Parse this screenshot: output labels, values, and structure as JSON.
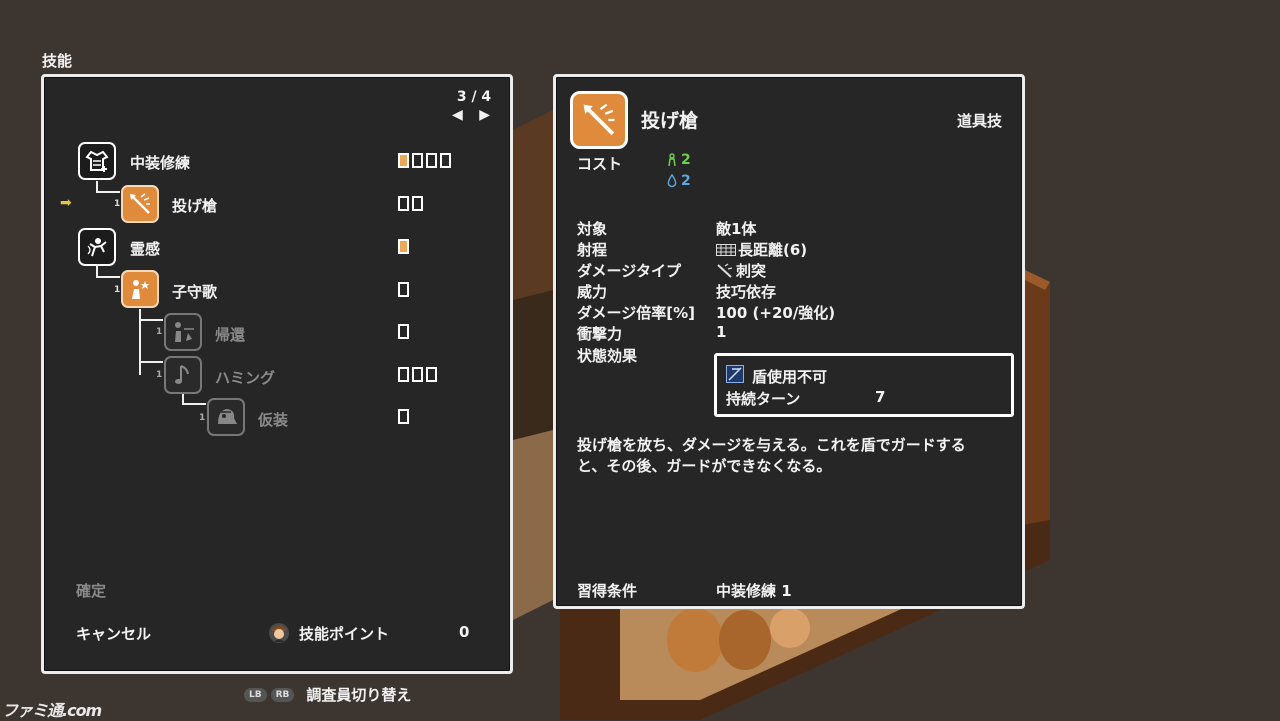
{
  "screen_title": "技能",
  "skill_tree": {
    "page": "3 / 4",
    "page_arrows": "◀ ▶",
    "nodes": [
      {
        "name": "中装修練",
        "level": "",
        "boxes_total": 4,
        "boxes_filled": 1,
        "state": "learned"
      },
      {
        "name": "投げ槍",
        "level": "1",
        "boxes_total": 2,
        "boxes_filled": 0,
        "state": "selected"
      },
      {
        "name": "霊感",
        "level": "",
        "boxes_total": 1,
        "boxes_filled": 1,
        "state": "learned"
      },
      {
        "name": "子守歌",
        "level": "1",
        "boxes_total": 1,
        "boxes_filled": 0,
        "state": "available"
      },
      {
        "name": "帰還",
        "level": "1",
        "boxes_total": 1,
        "boxes_filled": 0,
        "state": "locked"
      },
      {
        "name": "ハミング",
        "level": "1",
        "boxes_total": 3,
        "boxes_filled": 0,
        "state": "locked"
      },
      {
        "name": "仮装",
        "level": "1",
        "boxes_total": 1,
        "boxes_filled": 0,
        "state": "locked"
      }
    ],
    "confirm_label": "確定",
    "cancel_label": "キャンセル",
    "points_label": "技能ポイント",
    "points_value": "0"
  },
  "detail": {
    "name": "投げ槍",
    "category": "道具技",
    "cost_label": "コスト",
    "cost_stamina": "2",
    "cost_mana": "2",
    "stats": [
      {
        "label": "対象",
        "value": "敵1体"
      },
      {
        "label": "射程",
        "value": "長距離(6)"
      },
      {
        "label": "ダメージタイプ",
        "value": "刺突"
      },
      {
        "label": "威力",
        "value": "技巧依存"
      },
      {
        "label": "ダメージ倍率[%]",
        "value": "100 (+20/強化)"
      },
      {
        "label": "衝撃力",
        "value": "1"
      },
      {
        "label": "状態効果",
        "value": ""
      }
    ],
    "effect": {
      "name": "盾使用不可",
      "duration_label": "持続ターン",
      "duration_value": "7"
    },
    "description_line1": "投げ槍を放ち、ダメージを与える。これを盾でガードする",
    "description_line2": "と、その後、ガードができなくなる。",
    "requirement_label": "習得条件",
    "requirement_value": "中装修練 1"
  },
  "bottom_bar": {
    "lb": "LB",
    "rb": "RB",
    "label": "調査員切り替え"
  },
  "watermark": "ファミ通.com",
  "colors": {
    "panel": "#262626",
    "accent_orange": "#e08a3c",
    "stamina_green": "#6fcf4a",
    "mana_blue": "#59a9e0",
    "selector_yellow": "#e6c34a"
  }
}
